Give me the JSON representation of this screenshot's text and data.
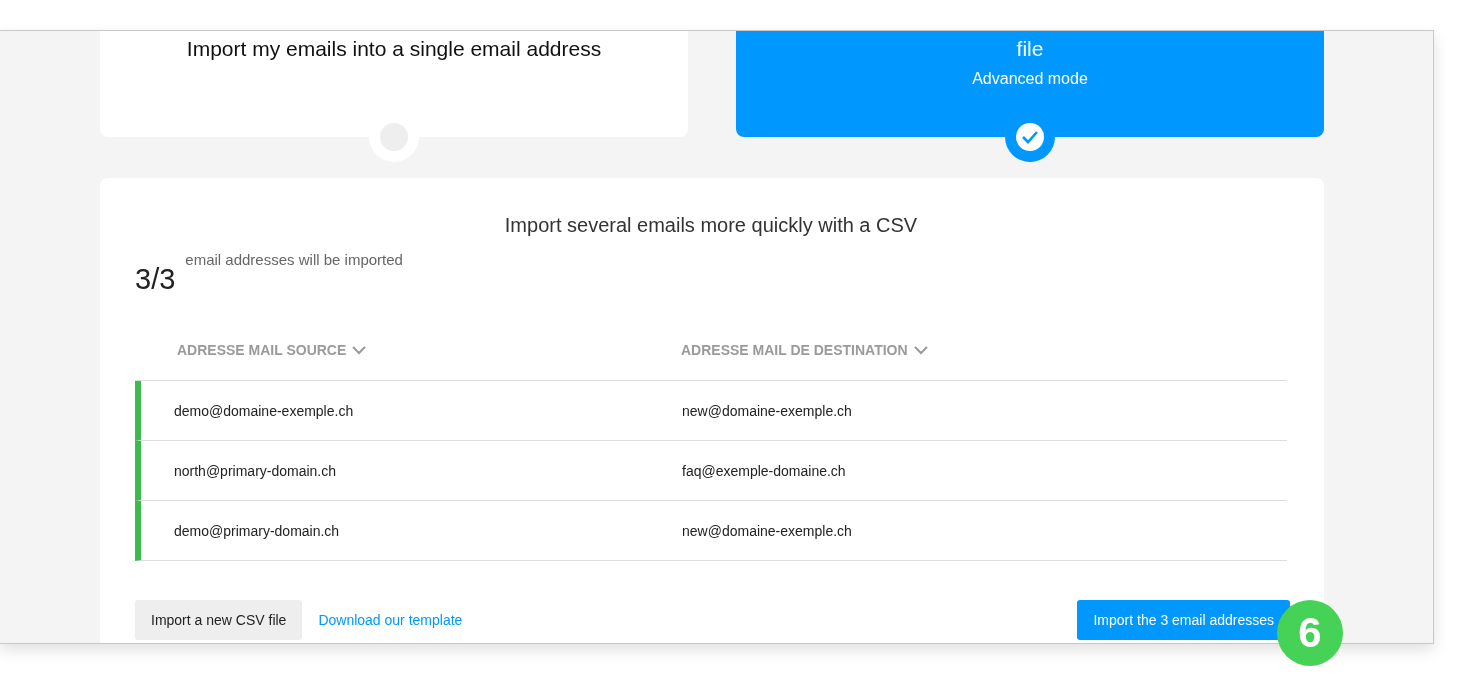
{
  "modes": [
    {
      "title": "Import my emails into a single email address",
      "selected": false
    },
    {
      "title": "file",
      "subtitle": "Advanced mode",
      "selected": true
    }
  ],
  "panel": {
    "heading": "Import several emails more quickly with a CSV",
    "count": "3/3",
    "count_label": "email addresses will be imported",
    "columns": [
      "ADRESSE MAIL SOURCE",
      "ADRESSE MAIL DE DESTINATION"
    ],
    "rows": [
      {
        "source": "demo@domaine-exemple.ch",
        "destination": "new@domaine-exemple.ch"
      },
      {
        "source": "north@primary-domain.ch",
        "destination": "faq@exemple-domaine.ch"
      },
      {
        "source": "demo@primary-domain.ch",
        "destination": "new@domaine-exemple.ch"
      }
    ],
    "import_new_button": "Import a new CSV file",
    "template_link": "Download our template",
    "import_button": "Import the 3 email addresses"
  },
  "step_badge": "6"
}
